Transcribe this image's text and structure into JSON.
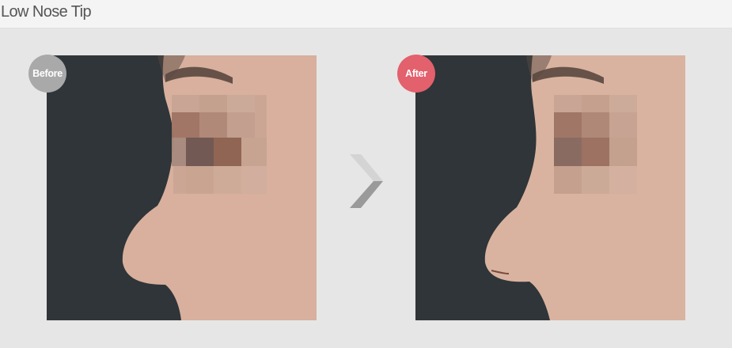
{
  "header": {
    "title": "Low Nose Tip"
  },
  "comparison": {
    "before": {
      "badge": "Before",
      "badge_color": "#a9a9a9"
    },
    "after": {
      "badge": "After",
      "badge_color": "#e3606d"
    },
    "arrow_icon": "chevron-right-icon"
  },
  "colors": {
    "background": "#e6e6e6",
    "header_background": "#f4f4f4",
    "photo_backdrop": "#2f3538",
    "skin": "#d9b3a0"
  }
}
